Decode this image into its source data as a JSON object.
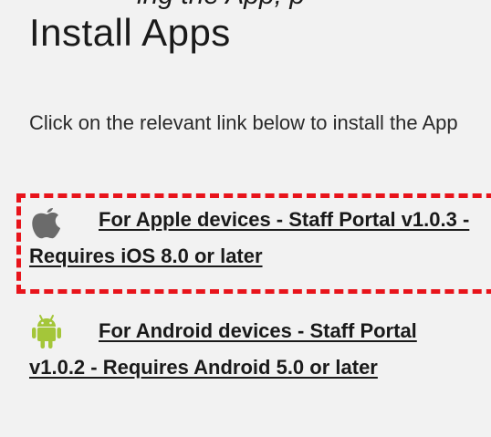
{
  "top_cut_text": "ing the App, p",
  "title": "Install Apps",
  "intro_text": "Click on the relevant link below to install the App",
  "apps": [
    {
      "icon": "apple-icon",
      "link_text": "For Apple devices - Staff Portal v1.0.3 - Requires iOS 8.0 or later",
      "icon_color": "#6b6b6b"
    },
    {
      "icon": "android-icon",
      "link_text": "For Android devices - Staff Portal v1.0.2 - Requires Android 5.0 or later",
      "icon_color": "#a4c639"
    }
  ],
  "highlight_color": "#e8141b"
}
